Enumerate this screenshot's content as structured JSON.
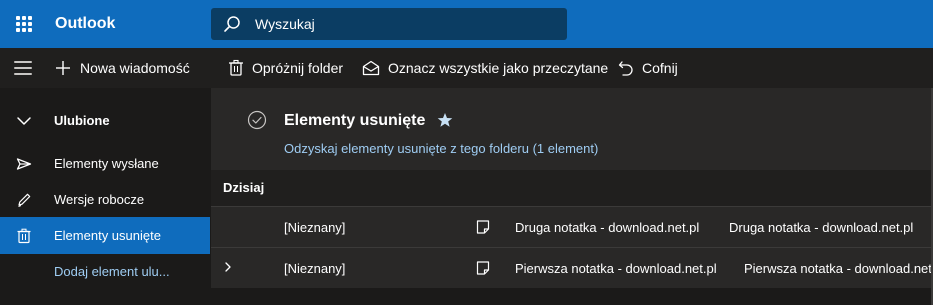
{
  "app": {
    "title": "Outlook"
  },
  "search": {
    "placeholder": "Wyszukaj"
  },
  "toolbar": {
    "new_message": "Nowa wiadomość",
    "empty_folder": "Opróżnij folder",
    "mark_all_read": "Oznacz wszystkie jako przeczytane",
    "undo": "Cofnij"
  },
  "sidebar": {
    "favorites": "Ulubione",
    "items": [
      {
        "label": "Elementy wysłane",
        "icon": "send-icon"
      },
      {
        "label": "Wersje robocze",
        "icon": "pencil-icon"
      },
      {
        "label": "Elementy usunięte",
        "icon": "trash-icon",
        "active": true
      },
      {
        "label": "Dodaj element ulu..."
      }
    ]
  },
  "folder": {
    "title": "Elementy usunięte",
    "recover": "Odzyskaj elementy usunięte z tego folderu (1 element)"
  },
  "group": {
    "label": "Dzisiaj"
  },
  "messages": [
    {
      "sender": "[Nieznany]",
      "subject": "Druga notatka - download.net.pl",
      "preview": "Druga notatka - download.net.pl"
    },
    {
      "sender": "[Nieznany]",
      "subject": "Pierwsza notatka - download.net.pl",
      "preview": "Pierwsza notatka - download.net.pl"
    }
  ],
  "colors": {
    "brand": "#0f6cbd",
    "link": "#9fcdf3",
    "background": "#1b1a19"
  }
}
